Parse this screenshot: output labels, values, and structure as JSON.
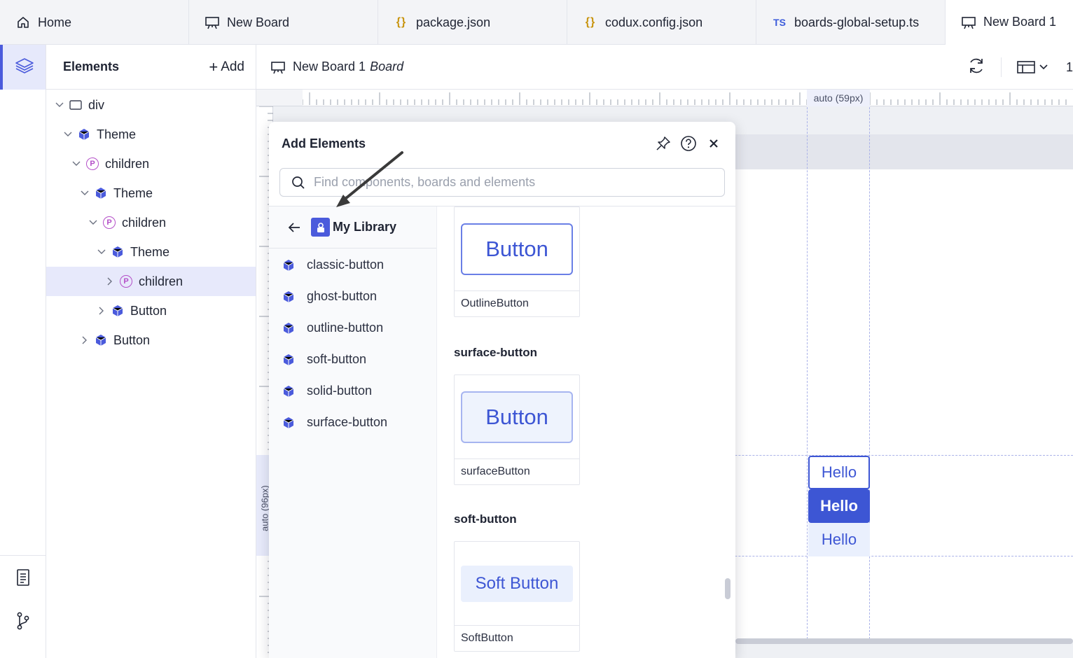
{
  "tabs": [
    {
      "label": "Home",
      "icon": "home-icon"
    },
    {
      "label": "New Board",
      "icon": "board-icon"
    },
    {
      "label": "package.json",
      "icon": "json-icon"
    },
    {
      "label": "codux.config.json",
      "icon": "json-icon"
    },
    {
      "label": "boards-global-setup.ts",
      "icon": "ts-icon"
    },
    {
      "label": "New Board 1",
      "icon": "board-icon"
    }
  ],
  "tab_icon_text": {
    "json": "{}",
    "ts": "TS"
  },
  "elements_panel": {
    "title": "Elements",
    "add_label": "Add",
    "tree": [
      {
        "label": "div",
        "icon": "div-icon",
        "expanded": true
      },
      {
        "label": "Theme",
        "icon": "component-icon",
        "expanded": true
      },
      {
        "label": "children",
        "icon": "prop-icon",
        "expanded": true
      },
      {
        "label": "Theme",
        "icon": "component-icon",
        "expanded": true
      },
      {
        "label": "children",
        "icon": "prop-icon",
        "expanded": true
      },
      {
        "label": "Theme",
        "icon": "component-icon",
        "expanded": true
      },
      {
        "label": "children",
        "icon": "prop-icon",
        "expanded": false,
        "selected": true
      },
      {
        "label": "Button",
        "icon": "component-icon",
        "expanded": false
      },
      {
        "label": "Button",
        "icon": "component-icon",
        "expanded": false
      }
    ],
    "prop_letter": "P"
  },
  "board_header": {
    "title": "New Board 1",
    "subtitle": "Board",
    "zoom": "1"
  },
  "canvas": {
    "width_label": "auto (59px)",
    "height_label": "auto (96px)",
    "preview_buttons": [
      "Hello",
      "Hello",
      "Hello"
    ]
  },
  "add_elements": {
    "title": "Add Elements",
    "search_placeholder": "Find components, boards and elements",
    "library_name": "My Library",
    "library_items": [
      "classic-button",
      "ghost-button",
      "outline-button",
      "soft-button",
      "solid-button",
      "surface-button"
    ],
    "sections": [
      {
        "heading": "",
        "preview_label": "Button",
        "caption": "OutlineButton",
        "style": "outline"
      },
      {
        "heading": "surface-button",
        "preview_label": "Button",
        "caption": "surfaceButton",
        "style": "surface"
      },
      {
        "heading": "soft-button",
        "preview_label": "Soft Button",
        "caption": "SoftButton",
        "style": "soft"
      }
    ]
  },
  "colors": {
    "accent": "#4b5bdc",
    "button_blue": "#3d56d4",
    "prop_purple": "#b44fc8"
  }
}
